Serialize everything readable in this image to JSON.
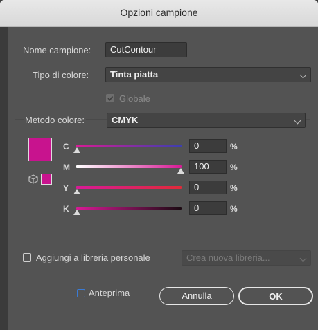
{
  "window": {
    "title": "Opzioni campione"
  },
  "form": {
    "swatch_name_label": "Nome campione:",
    "swatch_name_value": "CutContour",
    "color_type_label": "Tipo di colore:",
    "color_type_value": "Tinta piatta",
    "global_label": "Globale",
    "global_checked": true,
    "color_mode_label": "Metodo colore:",
    "color_mode_value": "CMYK"
  },
  "channels": [
    {
      "label": "C",
      "value": "0",
      "unit": "%"
    },
    {
      "label": "M",
      "value": "100",
      "unit": "%"
    },
    {
      "label": "Y",
      "value": "0",
      "unit": "%"
    },
    {
      "label": "K",
      "value": "0",
      "unit": "%"
    }
  ],
  "colors": {
    "swatch": "#c8138e",
    "accent": "#3a7bd5"
  },
  "library": {
    "add_label": "Aggiungi a libreria personale",
    "add_checked": false,
    "select_placeholder": "Crea nuova libreria..."
  },
  "footer": {
    "preview_label": "Anteprima",
    "preview_checked": false,
    "cancel_label": "Annulla",
    "ok_label": "OK"
  }
}
